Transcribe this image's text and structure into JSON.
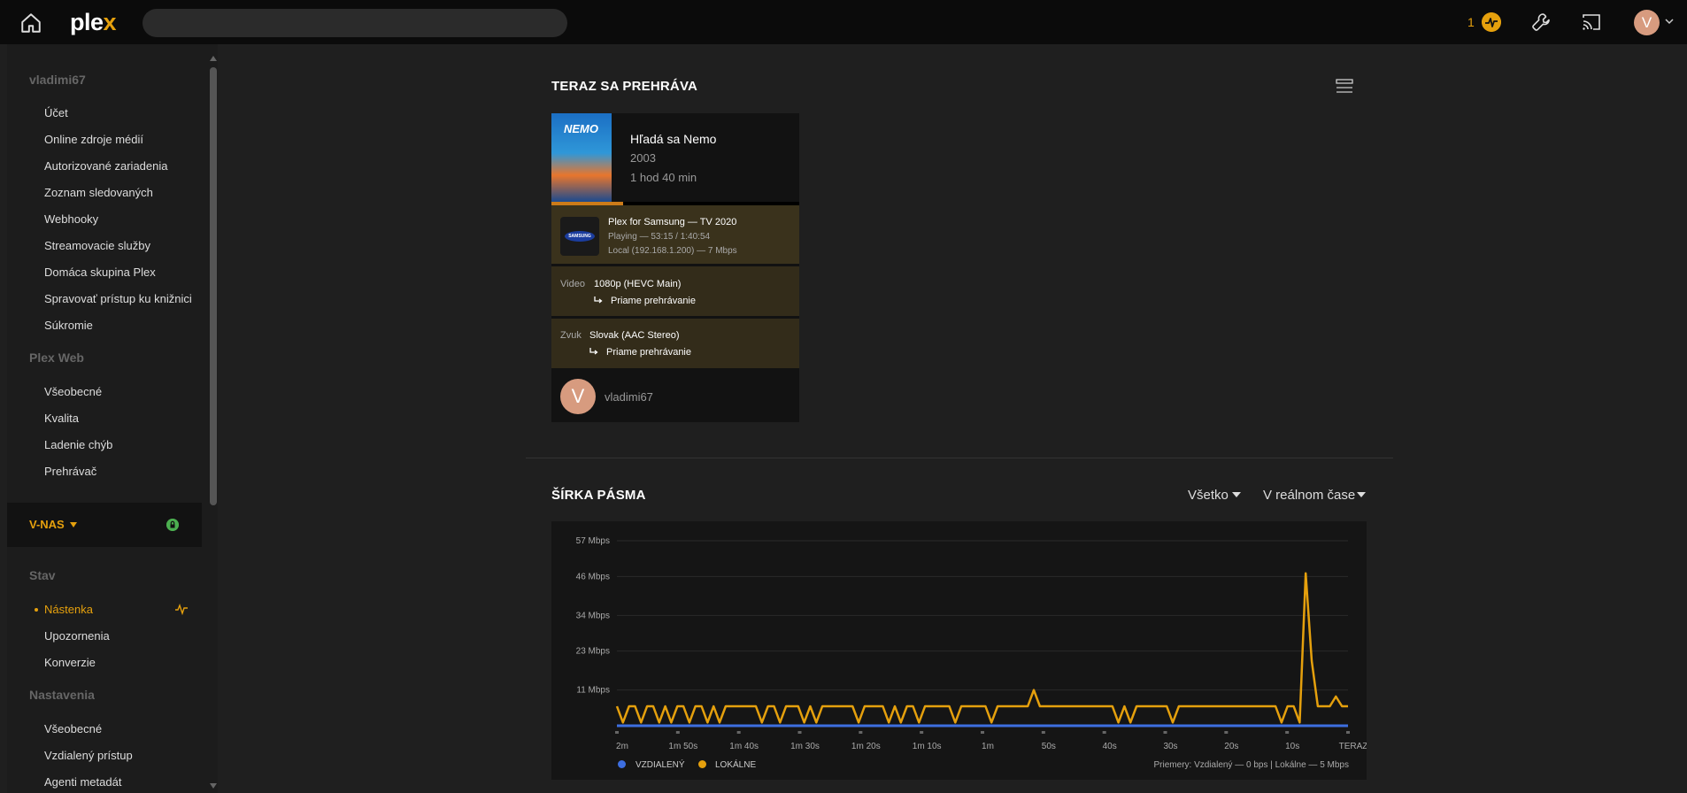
{
  "topbar": {
    "logo_main": "ple",
    "logo_accent": "x",
    "search_placeholder": "",
    "activity_count": "1",
    "avatar_letter": "V"
  },
  "sidebar": {
    "sections": [
      {
        "title": "vladimi67",
        "items": [
          "Účet",
          "Online zdroje médií",
          "Autorizované zariadenia",
          "Zoznam sledovaných",
          "Webhooky",
          "Streamovacie služby",
          "Domáca skupina Plex",
          "Spravovať prístup ku knižnici",
          "Súkromie"
        ]
      },
      {
        "title": "Plex Web",
        "items": [
          "Všeobecné",
          "Kvalita",
          "Ladenie chýb",
          "Prehrávač"
        ]
      }
    ],
    "server_name": "V-NAS",
    "sections2": [
      {
        "title": "Stav",
        "items": [
          "Nástenka",
          "Upozornenia",
          "Konverzie"
        ]
      },
      {
        "title": "Nastavenia",
        "items": [
          "Všeobecné",
          "Vzdialený prístup",
          "Agenti metadát"
        ]
      }
    ],
    "active_item": "Nástenka"
  },
  "now_playing": {
    "heading": "TERAZ SA PREHRÁVA",
    "poster_text": "NEMO",
    "title": "Hľadá sa Nemo",
    "year": "2003",
    "duration": "1 hod 40 min",
    "progress": 0.5,
    "player_name": "Plex for Samsung  —  TV 2020",
    "player_logo": "SAMSUNG",
    "player_state": "Playing — 53:15 / 1:40:54",
    "player_location": "Local (192.168.1.200) — 7 Mbps",
    "video_label": "Video",
    "video_value": "1080p (HEVC Main)",
    "video_mode": "Priame prehrávanie",
    "audio_label": "Zvuk",
    "audio_value": "Slovak (AAC Stereo)",
    "audio_mode": "Priame prehrávanie",
    "user_letter": "V",
    "user_name": "vladimi67"
  },
  "bandwidth": {
    "heading": "ŠÍRKA PÁSMA",
    "filter_label": "Všetko",
    "range_label": "V reálnom čase",
    "legend_remote": "VZDIALENÝ",
    "legend_local": "LOKÁLNE",
    "averages": "Priemery: Vzdialený — 0 bps | Lokálne — 5 Mbps",
    "colors": {
      "remote": "#3d6ee0",
      "local": "#e5a00d"
    }
  },
  "chart_data": {
    "type": "line",
    "x_tick_labels": [
      "2m",
      "1m 50s",
      "1m 40s",
      "1m 30s",
      "1m 20s",
      "1m 10s",
      "1m",
      "50s",
      "40s",
      "30s",
      "20s",
      "10s",
      "TERAZ"
    ],
    "y_tick_labels": [
      "57 Mbps",
      "46 Mbps",
      "34 Mbps",
      "23 Mbps",
      "11 Mbps"
    ],
    "y_ticks": [
      57,
      46,
      34,
      23,
      11
    ],
    "ylim": [
      0,
      57
    ],
    "grid": true,
    "legend": "bottom-left",
    "series": [
      {
        "name": "VZDIALENÝ",
        "values": [
          0,
          0,
          0,
          0,
          0,
          0,
          0,
          0,
          0,
          0,
          0,
          0,
          0,
          0,
          0,
          0,
          0,
          0,
          0,
          0,
          0,
          0,
          0,
          0,
          0,
          0,
          0,
          0,
          0,
          0,
          0,
          0,
          0,
          0,
          0,
          0,
          0,
          0,
          0,
          0,
          0,
          0,
          0,
          0,
          0,
          0,
          0,
          0,
          0,
          0,
          0,
          0,
          0,
          0,
          0,
          0,
          0,
          0,
          0,
          0,
          0,
          0,
          0,
          0,
          0,
          0,
          0,
          0,
          0,
          0,
          0,
          0,
          0,
          0,
          0,
          0,
          0,
          0,
          0,
          0,
          0,
          0,
          0,
          0,
          0,
          0,
          0,
          0,
          0,
          0,
          0,
          0,
          0,
          0,
          0,
          0,
          0,
          0,
          0,
          0,
          0,
          0,
          0,
          0,
          0,
          0,
          0,
          0,
          0,
          0,
          0,
          0,
          0,
          0,
          0,
          0,
          0,
          0,
          0,
          0,
          0
        ]
      },
      {
        "name": "LOKÁLNE",
        "values": [
          6,
          1,
          6,
          6,
          1,
          6,
          6,
          1,
          6,
          1,
          6,
          6,
          1,
          6,
          6,
          1,
          6,
          1,
          6,
          6,
          6,
          6,
          6,
          6,
          1,
          6,
          6,
          1,
          6,
          6,
          6,
          1,
          6,
          1,
          6,
          6,
          6,
          6,
          6,
          6,
          1,
          6,
          6,
          6,
          6,
          1,
          6,
          1,
          6,
          6,
          1,
          6,
          6,
          6,
          6,
          6,
          1,
          6,
          6,
          6,
          6,
          6,
          1,
          6,
          6,
          6,
          6,
          6,
          6,
          11,
          6,
          6,
          6,
          6,
          6,
          6,
          6,
          6,
          6,
          6,
          6,
          6,
          6,
          1,
          6,
          1,
          6,
          6,
          6,
          6,
          6,
          6,
          1,
          6,
          6,
          6,
          6,
          6,
          6,
          6,
          6,
          6,
          6,
          6,
          6,
          6,
          6,
          6,
          6,
          6,
          1,
          6,
          6,
          1,
          47,
          20,
          6,
          6,
          6,
          9,
          6,
          6
        ]
      }
    ]
  }
}
